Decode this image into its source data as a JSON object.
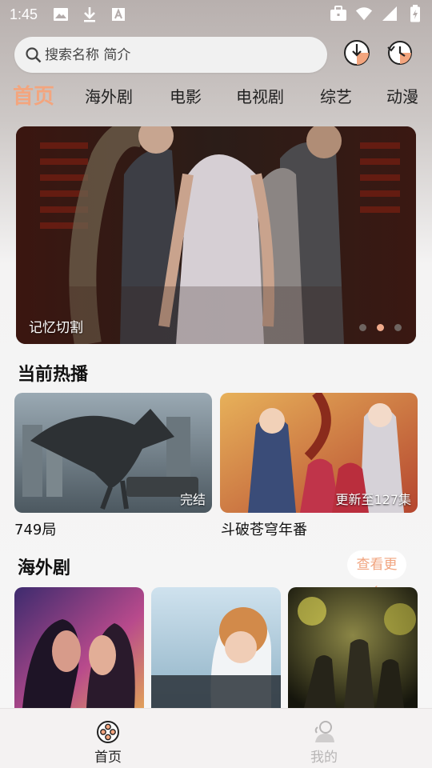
{
  "status_bar": {
    "time": "1:45"
  },
  "search": {
    "placeholder": "搜索名称 简介"
  },
  "tabs": [
    {
      "label": "首页",
      "active": true
    },
    {
      "label": "海外剧"
    },
    {
      "label": "电影"
    },
    {
      "label": "电视剧"
    },
    {
      "label": "综艺"
    },
    {
      "label": "动漫"
    }
  ],
  "banner": {
    "caption": "记忆切割",
    "dots": 3,
    "active_dot": 2
  },
  "hot": {
    "title": "当前热播",
    "items": [
      {
        "title": "749局",
        "badge": "完结"
      },
      {
        "title": "斗破苍穹年番",
        "badge": "更新至127集"
      }
    ]
  },
  "overseas": {
    "title": "海外剧",
    "more_label": "查看更多"
  },
  "bottom_nav": {
    "home_label": "首页",
    "mine_label": "我的"
  },
  "colors": {
    "accent": "#f3a57e",
    "nav_active": "#222222",
    "nav_inactive": "#b7b5b5"
  }
}
